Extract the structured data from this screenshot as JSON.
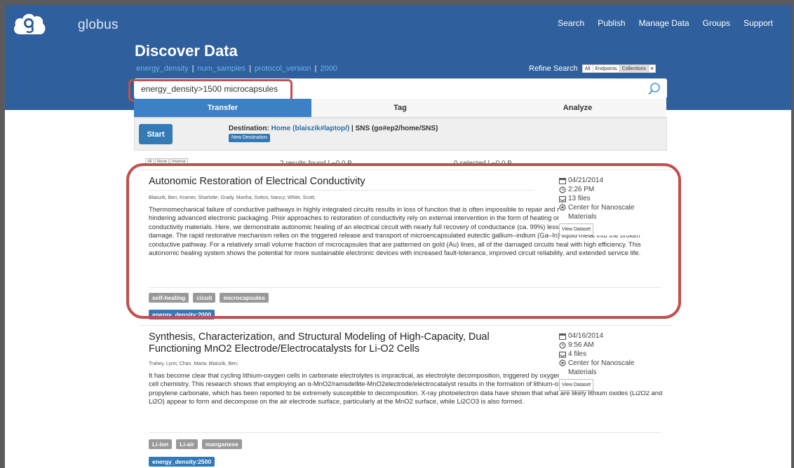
{
  "header": {
    "brand": "globus",
    "nav": [
      "Search",
      "Publish",
      "Manage Data",
      "Groups",
      "Support"
    ]
  },
  "page": {
    "title": "Discover Data",
    "facets": [
      "energy_density",
      "num_samples",
      "protocol_version",
      "2000"
    ]
  },
  "refine": {
    "label": "Refine Search",
    "options": [
      "All",
      "Endpoints",
      "Collections"
    ],
    "selected": "Collections"
  },
  "search": {
    "value": "energy_density>1500 microcapsules"
  },
  "tabs": [
    "Transfer",
    "Tag",
    "Analyze"
  ],
  "transfer": {
    "start_label": "Start",
    "destination_label": "Destination:",
    "destination_endpoint": "Home (blaiszik#laptop/)",
    "destination_path": "| SNS (go#ep2/home/SNS)",
    "new_destination": "New Destination"
  },
  "results_bar": {
    "select_buttons": [
      "All",
      "None",
      "Inverse"
    ],
    "found": "2 results found | ~0.0 B",
    "selected": "0 selected | ~0.0 B"
  },
  "results": [
    {
      "title": "Autonomic Restoration of Electrical Conductivity",
      "authors": "Blaiszik, Ben;  Kramer, Sharlotte;  Grady, Martha;  Sottos, Nancy;  White, Scott;",
      "abstract": "Thermomechanical failure of conductive pathways in highly integrated circuits results in loss of function that is often impossible to repair and remains a long-standing problem hindering advanced electronic packaging. Prior approaches to restoration of conductivity rely on external intervention in the form of heating or manual delivery of relatively low conductivity materials. Here, we demonstrate autonomic healing of an electrical circuit with nearly full recovery of conductance (ca. 99%) less than one millisecond after damage. The rapid restorative mechanism relies on the triggered release and transport of microencapsulated eutectic gallium–indium (Ga–In) liquid metal into the broken conductive pathway. For a relatively small volume fraction of microcapsules that are patterned on gold (Au) lines, all of the damaged circuits heal with high efficiency. This autonomic healing system shows the potential for more sustainable electronic devices with increased fault-tolerance, improved circuit reliability, and extended service life.",
      "date": "04/21/2014",
      "time": "2:26 PM",
      "files": "13 files",
      "center": "Center for Nanoscale Materials",
      "view": "View Dataset",
      "tags": [
        "self-healing",
        "cicuit",
        "microcapsules"
      ],
      "facet": "energy_density:2000"
    },
    {
      "title": "Synthesis, Characterization, and Structural Modeling of High-Capacity, Dual Functioning MnO2 Electrode/Electrocatalysts for Li-O2 Cells",
      "authors": "Trahey, Lynn;  Chan, Maria;  Blaiszik, Ben;",
      "abstract": "It has become clear that cycling lithium-oxygen cells in carbonate electrolytes is impractical, as electrolyte decomposition, triggered by oxygen reduction products, dominates the cell chemistry. This research shows that employing an α-MnO2/ramsdellite-MnO2electrode/electrocatalyst results in the formation of lithium-oxide-like discharge products in propylene carbonate, which has been reported to be extremely susceptible to decomposition. X-ray photoelectron data have shown that what are likely lithium oxides (Li2O2 and Li2O) appear to form and decompose on the air electrode surface, particularly at the MnO2 surface, while Li2CO3 is also formed.",
      "date": "04/16/2014",
      "time": "9:56 AM",
      "files": "4 files",
      "center": "Center for Nanoscale Materials",
      "view": "View Dataset",
      "tags": [
        "Li-ion",
        "Li-air",
        "manganese"
      ],
      "facet": "energy_density:2500"
    }
  ],
  "colors": {
    "header_bg": "#2f5f9c",
    "accent": "#337ab7",
    "highlight": "#c0504d",
    "tag_gray": "#999999"
  }
}
